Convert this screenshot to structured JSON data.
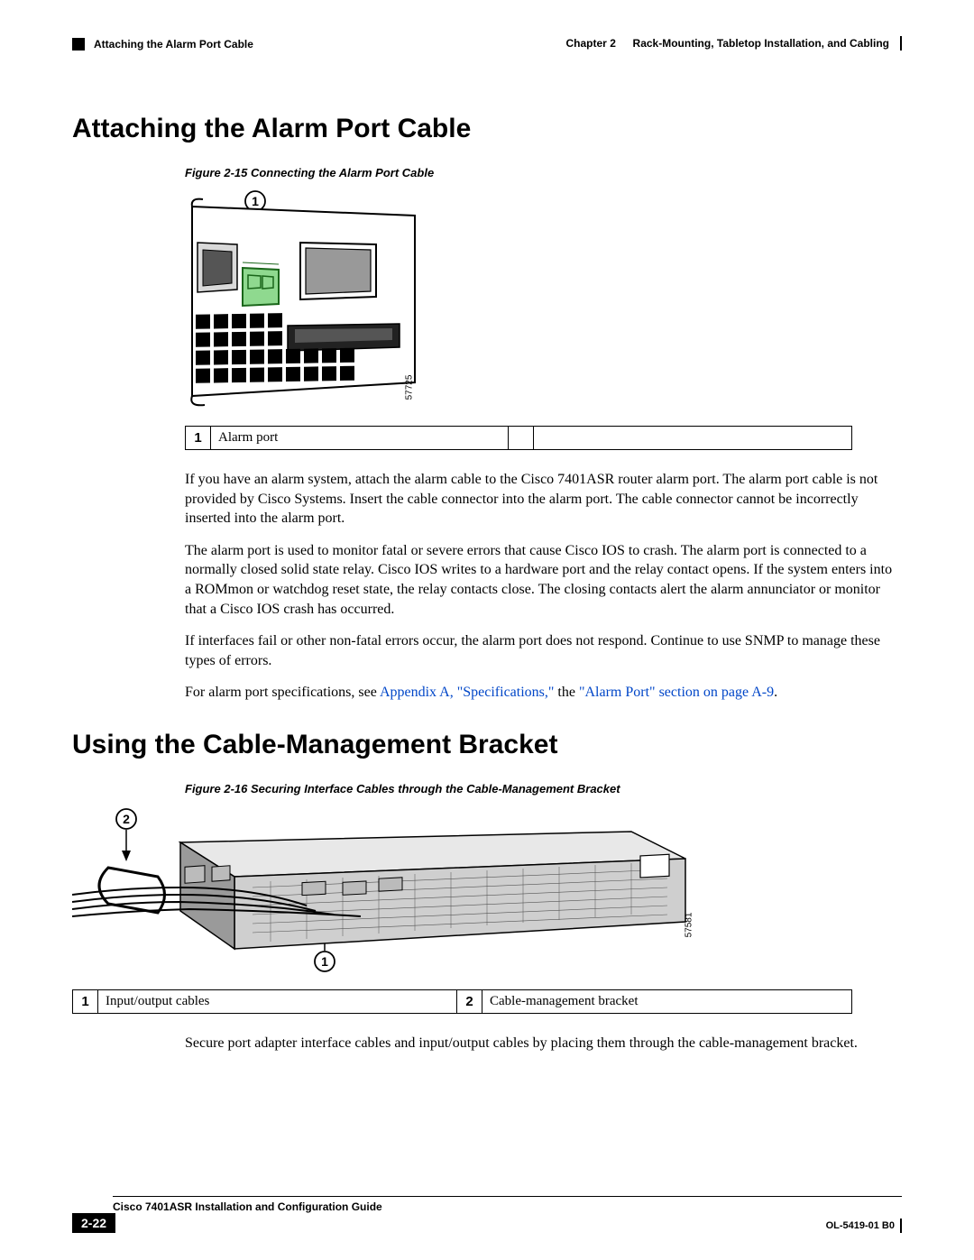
{
  "header": {
    "section": "Attaching the Alarm Port Cable",
    "chapter_label": "Chapter 2",
    "chapter_title": "Rack-Mounting, Tabletop Installation, and Cabling"
  },
  "section1": {
    "title": "Attaching the Alarm Port Cable",
    "figure_caption": "Figure 2-15   Connecting the Alarm Port Cable",
    "legend": {
      "n1": "1",
      "t1": "Alarm port",
      "t2": ""
    },
    "fig_num": "57725",
    "para1": "If you have an alarm system, attach the alarm cable to the Cisco 7401ASR router alarm port. The alarm port cable is not provided by Cisco Systems. Insert the cable connector into the alarm port. The cable connector cannot be incorrectly inserted into the alarm port.",
    "para2": "The alarm port is used to monitor fatal or severe errors that cause Cisco IOS to crash. The alarm port is connected to a normally closed solid state relay. Cisco IOS writes to a hardware port and the relay contact opens. If the system enters into a ROMmon or watchdog reset state, the relay contacts close. The closing contacts alert the alarm annunciator or monitor that a Cisco IOS crash has occurred.",
    "para3": "If interfaces fail or other non-fatal errors occur, the alarm port does not respond. Continue to use SNMP to manage these types of errors.",
    "para4_pre": "For alarm port specifications, see ",
    "para4_link1": "Appendix A, \"Specifications,\"",
    "para4_mid": " the ",
    "para4_link2": "\"Alarm Port\" section on page A-9",
    "para4_post": "."
  },
  "section2": {
    "title": "Using the Cable-Management Bracket",
    "figure_caption": "Figure 2-16   Securing Interface Cables through the Cable-Management Bracket",
    "fig_num": "57581",
    "legend": {
      "n1": "1",
      "t1": "Input/output cables",
      "n2": "2",
      "t2": "Cable-management bracket"
    },
    "para1": "Secure port adapter interface cables and input/output cables by placing them through the cable-management bracket."
  },
  "footer": {
    "doc_title": "Cisco 7401ASR Installation and Configuration Guide",
    "page_num": "2-22",
    "doc_code": "OL-5419-01 B0"
  },
  "callouts": {
    "c1": "1",
    "c2": "2"
  }
}
